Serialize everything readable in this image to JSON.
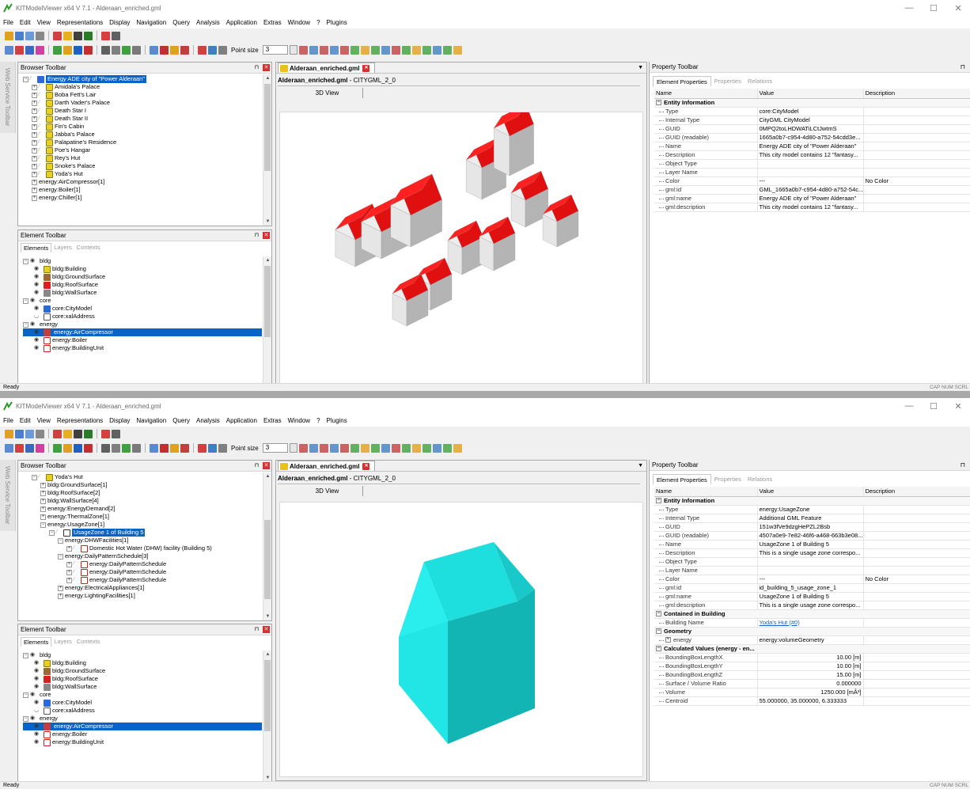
{
  "app": {
    "title": "KITModelViewer x64 V 7.1 - Alderaan_enriched.gml",
    "menu": [
      "File",
      "Edit",
      "View",
      "Representations",
      "Display",
      "Navigation",
      "Query",
      "Analysis",
      "Application",
      "Extras",
      "Window",
      "?",
      "Plugins"
    ],
    "point_size_label": "Point size",
    "point_size_value": "3",
    "web_service_toolbar": "Web Service Toolbar"
  },
  "panels": {
    "browser_title": "Browser Toolbar",
    "element_title": "Element Toolbar",
    "element_tabs": [
      "Elements",
      "Layers",
      "Contexts"
    ],
    "property_title": "Property Toolbar",
    "property_tabs": [
      "Element Properties",
      "Properties",
      "Relations"
    ]
  },
  "view": {
    "doc_tab": "Alderaan_enriched.gml",
    "doc_name": "Alderaan_enriched.gml",
    "doc_suffix": " - CITYGML_2_0",
    "view_tab": "3D View"
  },
  "browser1": [
    {
      "label": "Energy ADE city of \"Power Alderaan\"",
      "level": 0,
      "kind": "citymodel",
      "selected": true
    },
    {
      "label": "Amidala's Palace",
      "level": 1,
      "kind": "building"
    },
    {
      "label": "Boba Fett's Lair",
      "level": 1,
      "kind": "building"
    },
    {
      "label": "Darth Vader's Palace",
      "level": 1,
      "kind": "building"
    },
    {
      "label": "Death Star I",
      "level": 1,
      "kind": "building"
    },
    {
      "label": "Death Star II",
      "level": 1,
      "kind": "building"
    },
    {
      "label": "Fin's Cabin",
      "level": 1,
      "kind": "building"
    },
    {
      "label": "Jabba's Palace",
      "level": 1,
      "kind": "building"
    },
    {
      "label": "Palapatine's Residence",
      "level": 1,
      "kind": "building"
    },
    {
      "label": "Poe's Hangar",
      "level": 1,
      "kind": "building"
    },
    {
      "label": "Rey's Hut",
      "level": 1,
      "kind": "building"
    },
    {
      "label": "Snoke's Palace",
      "level": 1,
      "kind": "building"
    },
    {
      "label": "Yoda's Hut",
      "level": 1,
      "kind": "building"
    },
    {
      "label": "energy:AirCompressor[1]",
      "level": 1,
      "kind": "none"
    },
    {
      "label": "energy:Boiler[1]",
      "level": 1,
      "kind": "none"
    },
    {
      "label": "energy:Chiller[1]",
      "level": 1,
      "kind": "none"
    }
  ],
  "browser2": [
    {
      "label": "Yoda's Hut",
      "level": 1,
      "kind": "building"
    },
    {
      "label": "bldg:GroundSurface[1]",
      "level": 2,
      "kind": "none"
    },
    {
      "label": "bldg:RoofSurface[2]",
      "level": 2,
      "kind": "none"
    },
    {
      "label": "bldg:WallSurface[4]",
      "level": 2,
      "kind": "none"
    },
    {
      "label": "energy:EnergyDemand[2]",
      "level": 2,
      "kind": "none"
    },
    {
      "label": "energy:ThermalZone[1]",
      "level": 2,
      "kind": "none"
    },
    {
      "label": "energy:UsageZone[1]",
      "level": 2,
      "kind": "none"
    },
    {
      "label": "UsageZone 1 of Building 5",
      "level": 3,
      "kind": "uz",
      "selected": true
    },
    {
      "label": "energy:DHWFacilities[1]",
      "level": 4,
      "kind": "none"
    },
    {
      "label": "Domestic Hot Water (DHW) facility (Building 5)",
      "level": 5,
      "kind": "unknown"
    },
    {
      "label": "energy:DailyPatternSchedule[3]",
      "level": 4,
      "kind": "none"
    },
    {
      "label": "energy:DailyPatternSchedule",
      "level": 5,
      "kind": "unknown"
    },
    {
      "label": "energy:DailyPatternSchedule",
      "level": 5,
      "kind": "unknown"
    },
    {
      "label": "energy:DailyPatternSchedule",
      "level": 5,
      "kind": "unknown"
    },
    {
      "label": "energy:ElectricalAppliances[1]",
      "level": 4,
      "kind": "none"
    },
    {
      "label": "energy:LightingFacilities[1]",
      "level": 4,
      "kind": "none"
    }
  ],
  "elements": [
    {
      "label": "bldg",
      "level": 0,
      "group": true
    },
    {
      "label": "bldg:Building",
      "level": 1,
      "kind": "building"
    },
    {
      "label": "bldg:GroundSurface",
      "level": 1,
      "kind": "ground"
    },
    {
      "label": "bldg:RoofSurface",
      "level": 1,
      "kind": "roof"
    },
    {
      "label": "bldg:WallSurface",
      "level": 1,
      "kind": "wall"
    },
    {
      "label": "core",
      "level": 0,
      "group": true
    },
    {
      "label": "core:CityModel",
      "level": 1,
      "kind": "citymodel"
    },
    {
      "label": "core:xalAddress",
      "level": 1,
      "kind": "address",
      "hidden": true
    },
    {
      "label": "energy",
      "level": 0,
      "group": true
    },
    {
      "label": "energy:AirCompressor",
      "level": 1,
      "kind": "compressor",
      "selected": true
    },
    {
      "label": "energy:Boiler",
      "level": 1,
      "kind": "unknown"
    },
    {
      "label": "energy:BuildingUnit",
      "level": 1,
      "kind": "unknown"
    }
  ],
  "props_header": {
    "name": "Name",
    "value": "Value",
    "desc": "Description"
  },
  "props1": [
    {
      "group": "Entity Information"
    },
    {
      "name": "Type",
      "value": "core:CityModel",
      "desc": ""
    },
    {
      "name": "Internal Type",
      "value": "CityGML CityModel",
      "desc": ""
    },
    {
      "name": "GUID",
      "value": "0MPQ2toLHDWATiLCtJwtmS",
      "desc": ""
    },
    {
      "name": "GUID (readable)",
      "value": "1665a0b7-c954-4d80-a752-54cdd3e...",
      "desc": ""
    },
    {
      "name": "Name",
      "value": "Energy ADE city of \"Power Alderaan\"",
      "desc": ""
    },
    {
      "name": "Description",
      "value": "This city model contains 12 \"fantasy...",
      "desc": ""
    },
    {
      "name": "Object Type",
      "value": "",
      "desc": ""
    },
    {
      "name": "Layer Name",
      "value": "",
      "desc": ""
    },
    {
      "name": "Color",
      "value": "---",
      "desc": "No Color"
    },
    {
      "name": "gml:id",
      "value": "GML_1665a0b7-c954-4d80-a752-54c...",
      "desc": ""
    },
    {
      "name": "gml:name",
      "value": "Energy ADE city of \"Power Alderaan\"",
      "desc": ""
    },
    {
      "name": "gml:description",
      "value": "This city model contains 12 \"fantasy...",
      "desc": ""
    }
  ],
  "props2": [
    {
      "group": "Entity Information"
    },
    {
      "name": "Type",
      "value": "energy:UsageZone",
      "desc": ""
    },
    {
      "name": "Internal Type",
      "value": "Additional GML Feature",
      "desc": ""
    },
    {
      "name": "GUID",
      "value": "151w3fVe9dzgHePZL2Bsb",
      "desc": ""
    },
    {
      "name": "GUID (readable)",
      "value": "4507a0e9-7e82-46f6-a468-663b3e08...",
      "desc": ""
    },
    {
      "name": "Name",
      "value": "UsageZone 1 of Building 5",
      "desc": ""
    },
    {
      "name": "Description",
      "value": "This is a single usage zone correspo...",
      "desc": ""
    },
    {
      "name": "Object Type",
      "value": "",
      "desc": ""
    },
    {
      "name": "Layer Name",
      "value": "",
      "desc": ""
    },
    {
      "name": "Color",
      "value": "---",
      "desc": "No Color"
    },
    {
      "name": "gml:id",
      "value": "id_building_5_usage_zone_1",
      "desc": ""
    },
    {
      "name": "gml:name",
      "value": "UsageZone 1 of Building 5",
      "desc": ""
    },
    {
      "name": "gml:description",
      "value": "This is a single usage zone correspo...",
      "desc": ""
    },
    {
      "group": "Contained in Building"
    },
    {
      "name": "Building Name",
      "value": "Yoda's Hut (#0)",
      "desc": "",
      "link": true
    },
    {
      "group": "Geometry"
    },
    {
      "name": "energy",
      "value": "energy:volumeGeometry",
      "desc": "",
      "expand": true
    },
    {
      "group": "Calculated Values (energy - en..."
    },
    {
      "name": "BoundingBoxLengthX",
      "value": "10.00 [m]",
      "desc": "",
      "right": true
    },
    {
      "name": "BoundingBoxLengthY",
      "value": "10.00 [m]",
      "desc": "",
      "right": true
    },
    {
      "name": "BoundingBoxLengthZ",
      "value": "15.00 [m]",
      "desc": "",
      "right": true
    },
    {
      "name": "Surface / Volume Ratio",
      "value": "0.000000",
      "desc": "",
      "right": true
    },
    {
      "name": "Volume",
      "value": "1250.000 [mÂ³]",
      "desc": "",
      "right": true
    },
    {
      "name": "Centroid",
      "value": "55.000000, 35.000000, 6.333333",
      "desc": ""
    }
  ],
  "status": {
    "text": "Ready",
    "caps": "CAP NUM SCRL"
  },
  "colors": {
    "roof": "#e81010",
    "wall": "#c9c9c9",
    "zone": "#1ee0e0",
    "select": "#0a64c8"
  }
}
